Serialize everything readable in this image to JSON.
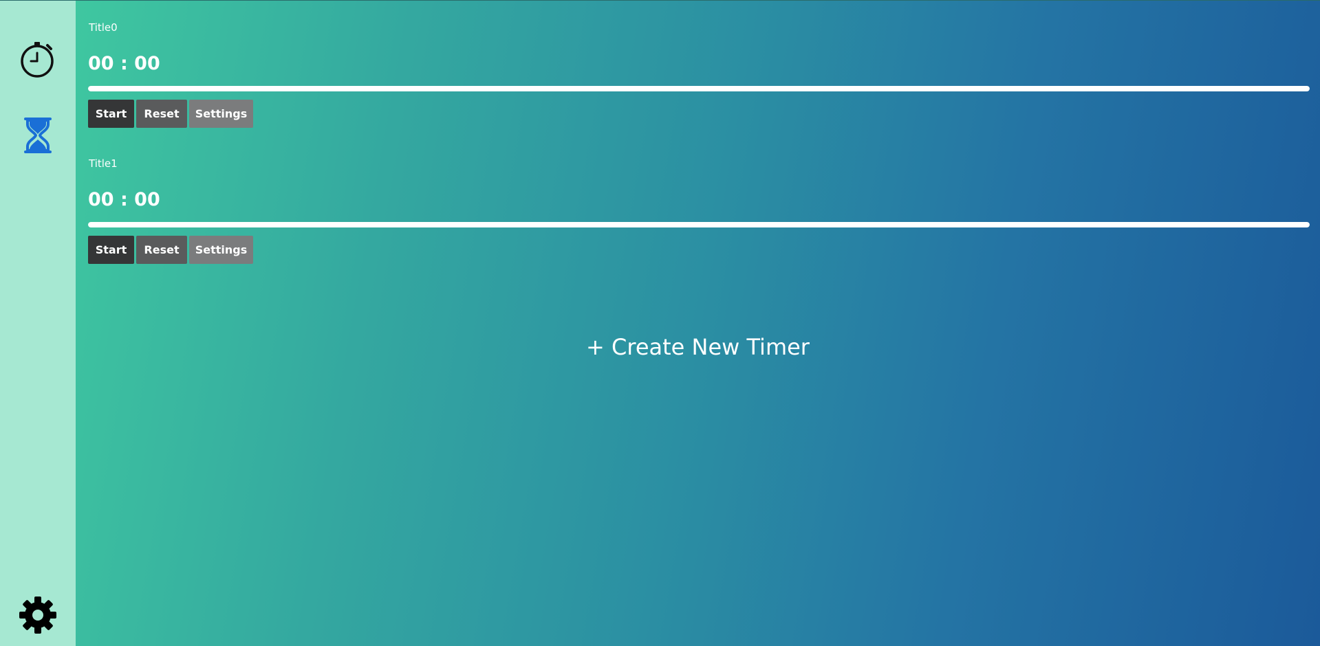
{
  "sidebar": {
    "icons": [
      {
        "name": "stopwatch-icon",
        "color": "#111111"
      },
      {
        "name": "hourglass-icon",
        "color": "#1a6fd6"
      },
      {
        "name": "gear-icon",
        "color": "#000000"
      }
    ],
    "background": "#a6e8d2"
  },
  "timers": [
    {
      "title": "Title0",
      "time": "00 : 00",
      "progress": 1.0,
      "buttons": {
        "start": "Start",
        "reset": "Reset",
        "settings": "Settings"
      }
    },
    {
      "title": "Title1",
      "time": "00 : 00",
      "progress": 1.0,
      "buttons": {
        "start": "Start",
        "reset": "Reset",
        "settings": "Settings"
      }
    }
  ],
  "create_timer": {
    "label": "+ Create New Timer"
  },
  "colors": {
    "gradient_start": "#3fc7a0",
    "gradient_end": "#1b5a9a",
    "start_button": "#353637",
    "reset_button": "#5a5b5c",
    "settings_button": "#7b7c7d"
  }
}
